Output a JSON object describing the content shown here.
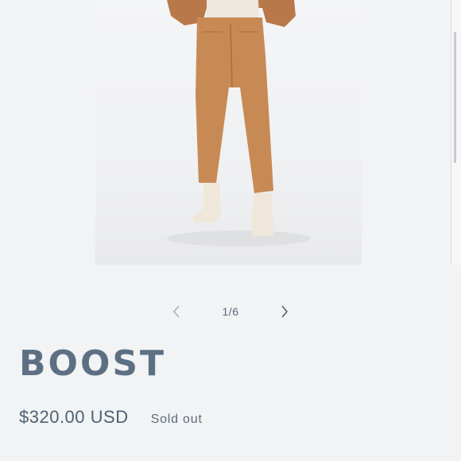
{
  "gallery": {
    "counter": "1/6",
    "prev_icon": "chevron-left-icon",
    "next_icon": "chevron-right-icon"
  },
  "product": {
    "title": "BOOST",
    "price": "$320.00 USD",
    "status": "Sold out"
  },
  "colors": {
    "background": "#f1f3f5",
    "title": "#5d7083",
    "text": "#4f6172",
    "pants": "#c88a55"
  }
}
